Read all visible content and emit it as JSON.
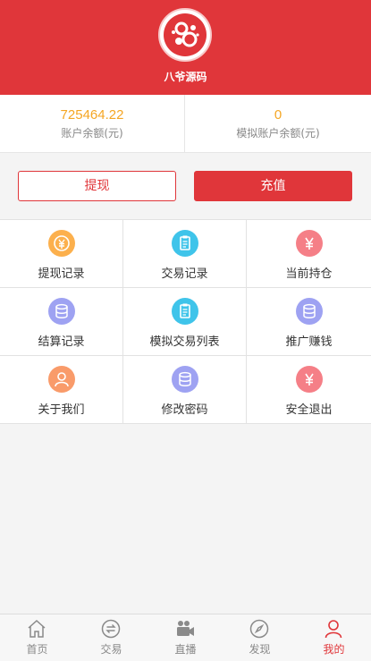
{
  "colors": {
    "brand": "#e0363a",
    "balance": "#f5a623",
    "tab_active": "#e0363a",
    "tab_inactive": "#888888"
  },
  "profile": {
    "name": "八爷源码",
    "avatar_icon": "logo-bubbles-icon"
  },
  "balance": {
    "account_value": "725464.22",
    "account_label": "账户余额(元)",
    "sim_value": "0",
    "sim_label": "模拟账户余额(元)"
  },
  "actions": {
    "withdraw_label": "提现",
    "recharge_label": "充值"
  },
  "menu": [
    {
      "label": "提现记录",
      "icon": "coin-icon",
      "color": "#fcb04d"
    },
    {
      "label": "交易记录",
      "icon": "clipboard-icon",
      "color": "#3fc4ea"
    },
    {
      "label": "当前持仓",
      "icon": "yen-icon",
      "color": "#f57f87"
    },
    {
      "label": "结算记录",
      "icon": "database-icon",
      "color": "#9ea2f2"
    },
    {
      "label": "模拟交易列表",
      "icon": "clipboard-icon",
      "color": "#3fc4ea"
    },
    {
      "label": "推广赚钱",
      "icon": "database-icon",
      "color": "#9ea2f2"
    },
    {
      "label": "关于我们",
      "icon": "user-icon",
      "color": "#f99b6a"
    },
    {
      "label": "修改密码",
      "icon": "database-icon",
      "color": "#9ea2f2"
    },
    {
      "label": "安全退出",
      "icon": "yen-icon",
      "color": "#f57f87"
    }
  ],
  "tabbar": [
    {
      "label": "首页",
      "icon": "home-icon",
      "active": false
    },
    {
      "label": "交易",
      "icon": "exchange-icon",
      "active": false
    },
    {
      "label": "直播",
      "icon": "video-camera-icon",
      "active": false
    },
    {
      "label": "发现",
      "icon": "compass-icon",
      "active": false
    },
    {
      "label": "我的",
      "icon": "user-icon",
      "active": true
    }
  ]
}
